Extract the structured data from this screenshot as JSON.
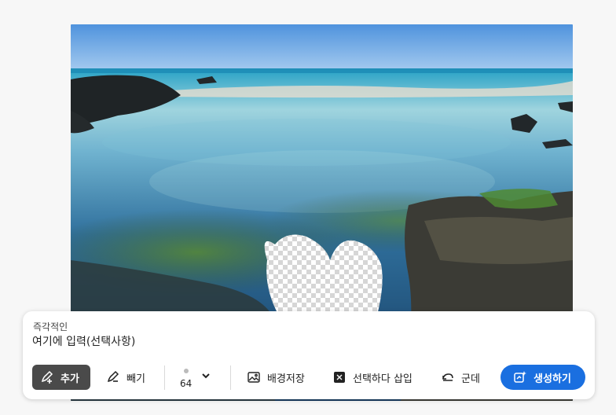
{
  "panel": {
    "label": "즉각적인",
    "input_placeholder": "여기에 입력(선택사항)",
    "input_value": ""
  },
  "toolbar": {
    "add_label": "추가",
    "subtract_label": "빼기",
    "brush_size": "64",
    "save_background_label": "배경저장",
    "select_insert_label": "선택하다 삽입",
    "undo_label": "군데",
    "generate_label": "생성하기"
  },
  "colors": {
    "accent": "#1a6fe0",
    "add_button": "#4a4a4a",
    "sky_top": "#5e9fe0",
    "sea": "#1d5f8a"
  },
  "icons": {
    "add": "brush-plus-icon",
    "subtract": "brush-minus-icon",
    "size_chevron": "chevron-down-icon",
    "background": "image-icon",
    "insert": "select-insert-icon",
    "undo": "undo-icon",
    "generate": "sparkle-generate-icon"
  }
}
